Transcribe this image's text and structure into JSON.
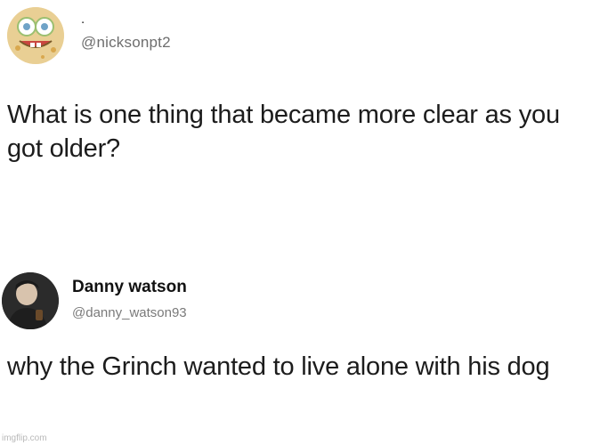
{
  "tweet_1": {
    "dot": ".",
    "handle": "@nicksonpt2",
    "text": "What is one thing that became more clear as you got older?"
  },
  "tweet_2": {
    "name": "Danny watson",
    "handle": "@danny_watson93",
    "text": "why the Grinch wanted to live alone with his dog"
  },
  "watermark": "imgflip.com",
  "colors": {
    "background": "#ffffff",
    "text": "#1c1c1c",
    "handle": "#6e6e6e"
  }
}
